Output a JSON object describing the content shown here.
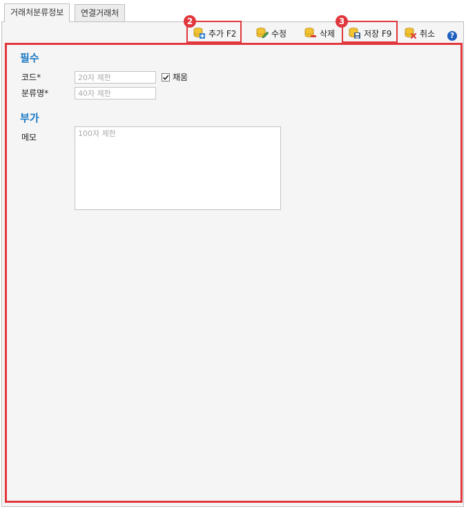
{
  "tabs": [
    {
      "label": "거래처분류정보",
      "active": true
    },
    {
      "label": "연결거래처",
      "active": false
    }
  ],
  "toolbar": {
    "add_label": "추가 F2",
    "edit_label": "수정",
    "delete_label": "삭제",
    "save_label": "저장 F9",
    "cancel_label": "취소",
    "help_label": "?"
  },
  "callouts": {
    "add": "2",
    "save": "3",
    "color": "#e0363c"
  },
  "form": {
    "required_section": "필수",
    "code_label": "코드",
    "code_placeholder": "20자 제한",
    "code_value": "",
    "auto_label": "채움",
    "auto_checked": true,
    "name_label": "분류명",
    "name_placeholder": "40자 제한",
    "name_value": "",
    "required_marker": "*",
    "optional_section": "부가",
    "memo_label": "메모",
    "memo_placeholder": "100자 제한",
    "memo_value": ""
  },
  "colors": {
    "section_title": "#1a78c2",
    "highlight": "#e0363c",
    "panel_bg": "#f5f5f5"
  }
}
